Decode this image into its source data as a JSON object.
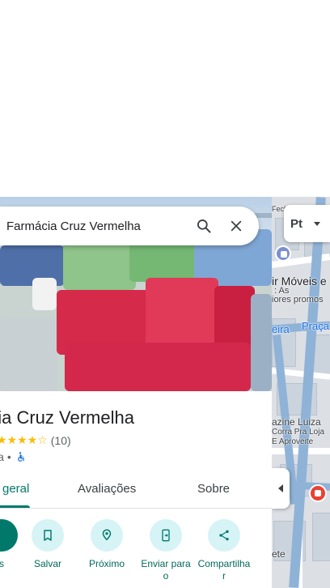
{
  "search": {
    "query": "Farmácia Cruz Vermelha"
  },
  "place": {
    "name": "ácia Cruz Vermelha",
    "stars": "★★★★☆",
    "review_count": "(10)",
    "category": "ia",
    "separator": "•",
    "accessible_icon": "wheelchair-icon"
  },
  "tabs": [
    {
      "label": "geral",
      "active": true
    },
    {
      "label": "Avaliações",
      "active": false
    },
    {
      "label": "Sobre",
      "active": false
    }
  ],
  "actions": [
    {
      "label": "s",
      "icon": "directions-icon"
    },
    {
      "label": "Salvar",
      "icon": "bookmark-icon"
    },
    {
      "label": "Próximo",
      "icon": "nearby-icon"
    },
    {
      "label": "Enviar para o",
      "icon": "send-to-phone-icon"
    },
    {
      "label": "Compartilha r",
      "icon": "share-icon"
    }
  ],
  "map": {
    "layer_label": "Pt",
    "labels": {
      "top": "Fech",
      "moveis": "ir Móveis e",
      "as": ": As",
      "promos": "iores promos",
      "praca": "Praça",
      "eira": "eira",
      "magazine": "azine Luiza",
      "corra": "Corra Pra Loja",
      "aproveite": "E Aproveite",
      "ete": "ete"
    }
  },
  "colors": {
    "accent": "#00796b",
    "action_bg": "#d6f3f6",
    "star": "#fbbc04",
    "map_road": "#8fb2d7",
    "pin_red": "#e94235"
  }
}
